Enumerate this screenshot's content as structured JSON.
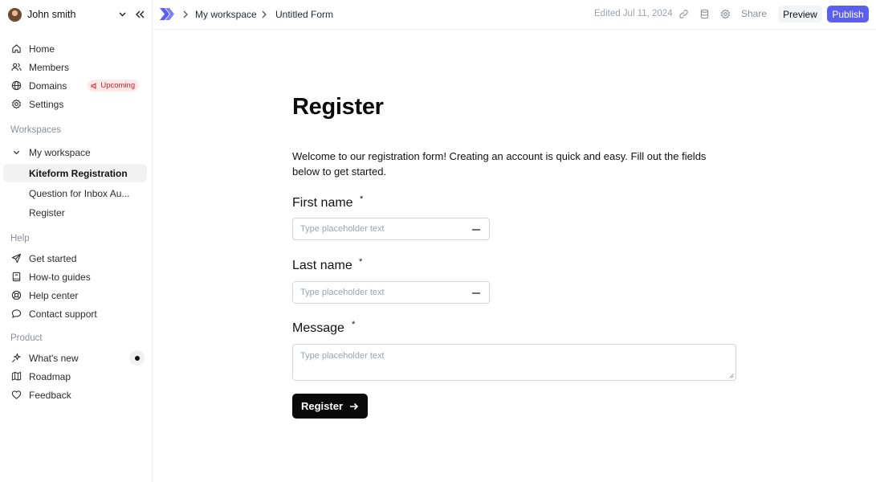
{
  "user": {
    "name": "John smith"
  },
  "sidebar": {
    "main_items": [
      {
        "label": "Home",
        "icon": "home-icon"
      },
      {
        "label": "Members",
        "icon": "users-icon"
      },
      {
        "label": "Domains",
        "icon": "globe-icon",
        "badge": "Upcoming"
      },
      {
        "label": "Settings",
        "icon": "gear-icon"
      }
    ],
    "workspaces_label": "Workspaces",
    "workspace": {
      "name": "My workspace",
      "forms": [
        "Kiteform Registration",
        "Question for Inbox Au...",
        "Register"
      ],
      "active_index": 0
    },
    "help_label": "Help",
    "help_items": [
      {
        "label": "Get started",
        "icon": "send-icon"
      },
      {
        "label": "How-to guides",
        "icon": "book-icon"
      },
      {
        "label": "Help center",
        "icon": "lifebuoy-icon"
      },
      {
        "label": "Contact support",
        "icon": "chat-bubble-icon"
      }
    ],
    "product_label": "Product",
    "product_items": [
      {
        "label": "What's new",
        "icon": "sparkle-icon"
      },
      {
        "label": "Roadmap",
        "icon": "map-icon"
      },
      {
        "label": "Feedback",
        "icon": "heart-icon"
      }
    ]
  },
  "topbar": {
    "breadcrumb": [
      "My workspace",
      "Untitled Form"
    ],
    "edited": "Edited Jul 11, 2024",
    "share_label": "Share",
    "preview_label": "Preview",
    "publish_label": "Publish"
  },
  "form": {
    "title": "Register",
    "description": "Welcome to our registration form! Creating an account is quick and easy. Fill out the fields below to get started.",
    "required_mark": "*",
    "fields": [
      {
        "label": "First name",
        "placeholder": "Type placeholder text"
      },
      {
        "label": "Last name",
        "placeholder": "Type placeholder text"
      },
      {
        "label": "Message",
        "placeholder": "Type placeholder text"
      }
    ],
    "submit_label": "Register"
  },
  "colors": {
    "accent": "#5b5ff0",
    "badge_bg": "#fde7e7",
    "badge_text": "#c62828",
    "submit_bg": "#0a0a0a"
  }
}
